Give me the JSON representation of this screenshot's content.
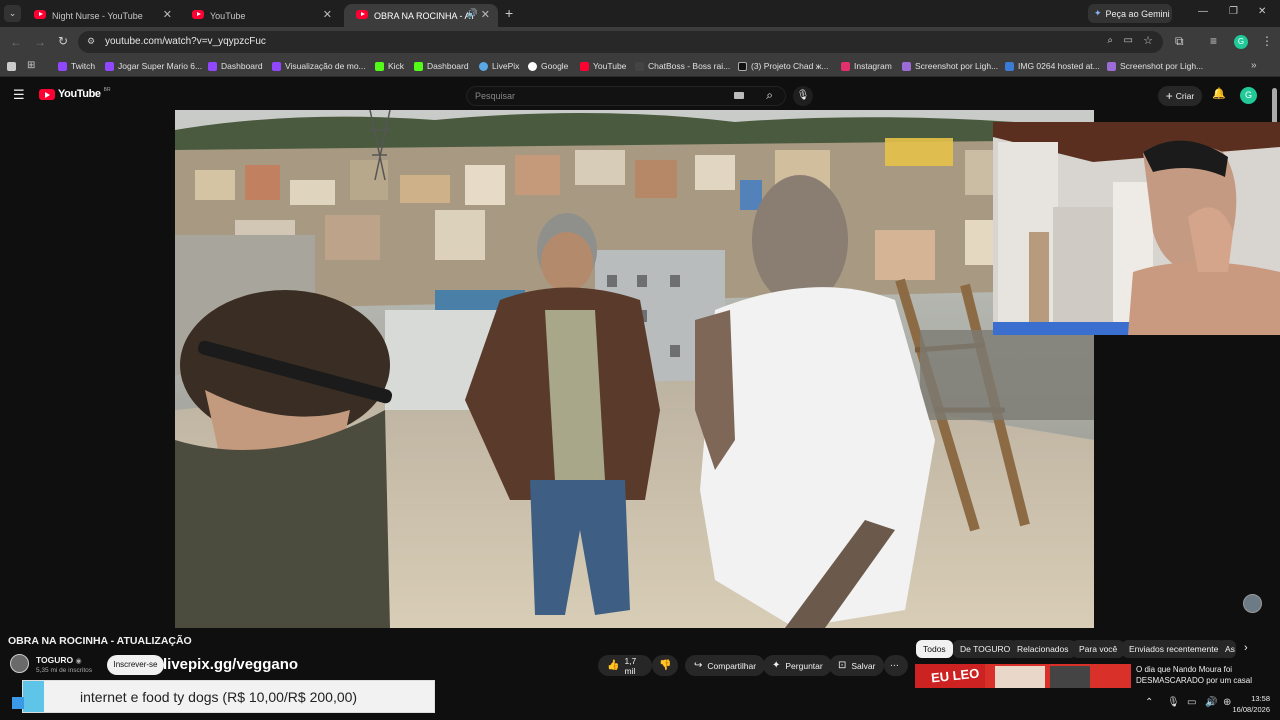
{
  "tabs": [
    {
      "title": "Night Nurse - YouTube",
      "active": false
    },
    {
      "title": "YouTube",
      "active": false
    },
    {
      "title": "OBRA NA ROCINHA - ATUA",
      "active": true
    }
  ],
  "gemini": "Peça ao Gemini",
  "url": "youtube.com/watch?v=v_yqypzcFuc",
  "bookmarks": [
    "Twitch",
    "Jogar Super Mario 6...",
    "Dashboard",
    "Visualização de mo...",
    "Kick",
    "Dashboard",
    "LivePix",
    "Google",
    "YouTube",
    "ChatBoss - Boss rai...",
    "(3) Projeto Chad ж...",
    "Instagram",
    "Screenshot por Ligh...",
    "IMG 0264 hosted at...",
    "Screenshot por Ligh..."
  ],
  "yt": {
    "logo": "YouTube",
    "logo_sup": "BR",
    "search_placeholder": "Pesquisar",
    "create": "Criar",
    "avatar": "G"
  },
  "video": {
    "title": "OBRA NA ROCINHA - ATUALIZAÇÃO",
    "channel": "TOGURO",
    "subs": "5,35 mi de inscritos",
    "subscribe": "Inscrever-se",
    "likes": "1,7 mil",
    "share": "Compartilhar",
    "ask": "Perguntar",
    "save": "Salvar"
  },
  "overlay": {
    "livepix": "livepix.gg/veggano",
    "donation": "internet e food ty dogs (R$ 10,00/R$ 200,00)",
    "donation_progress": 0.05
  },
  "chips": [
    "Todos",
    "De TOGURO",
    "Relacionados",
    "Para você",
    "Enviados recentemente",
    "As"
  ],
  "rec": {
    "title": "O dia que Nando Moura foi DESMASCARADO por um casal de",
    "thumb_text": "EU LEO"
  },
  "taskbar": {
    "time": "13:58",
    "date": "16/08/2026"
  },
  "colors": {
    "yt_red": "#ff0033",
    "accent_green": "#20c997"
  }
}
